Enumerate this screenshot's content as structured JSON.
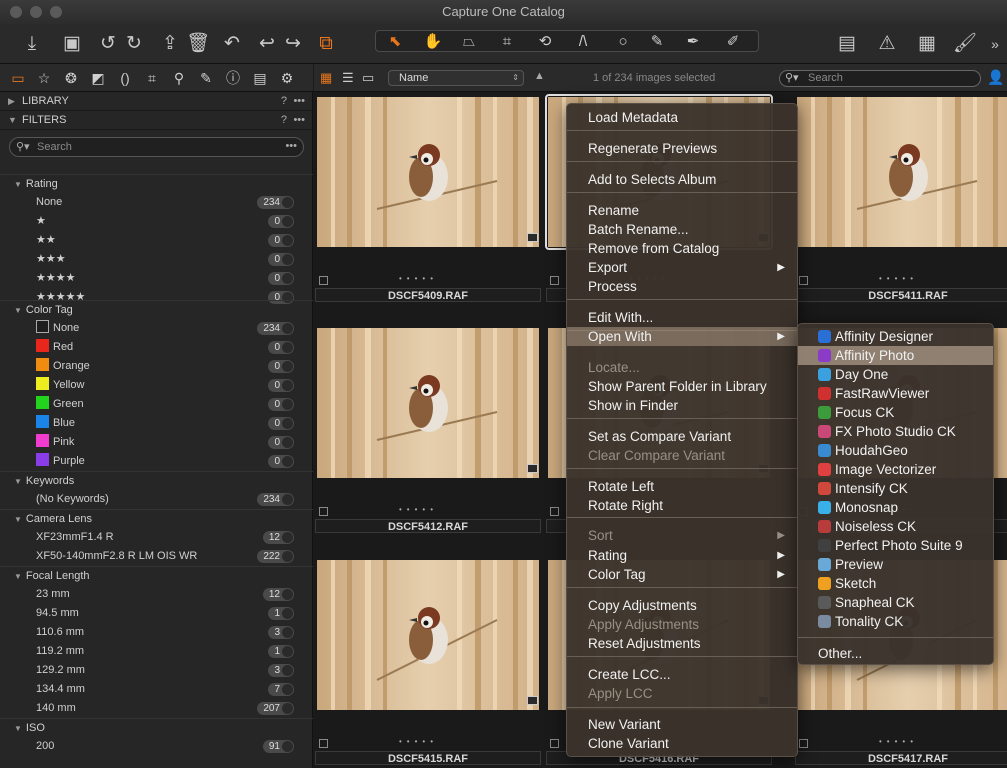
{
  "window": {
    "title": "Capture One Catalog"
  },
  "browser": {
    "sort_field": "Name",
    "selection_status": "1 of 234 images selected",
    "search_placeholder": "Search",
    "thumbnails": [
      {
        "filename": "DSCF5409.RAF"
      },
      {
        "filename": ""
      },
      {
        "filename": "DSCF5411.RAF"
      },
      {
        "filename": "DSCF5412.RAF"
      },
      {
        "filename": ""
      },
      {
        "filename": ""
      },
      {
        "filename": "DSCF5415.RAF"
      },
      {
        "filename": "DSCF5416.RAF"
      },
      {
        "filename": "DSCF5417.RAF"
      }
    ]
  },
  "sidebar": {
    "library_label": "LIBRARY",
    "filters_label": "FILTERS",
    "search_placeholder": "Search",
    "rating": {
      "title": "Rating",
      "items": [
        {
          "label": "None",
          "count": "234"
        },
        {
          "label": "★",
          "count": "0"
        },
        {
          "label": "★★",
          "count": "0"
        },
        {
          "label": "★★★",
          "count": "0"
        },
        {
          "label": "★★★★",
          "count": "0"
        },
        {
          "label": "★★★★★",
          "count": "0"
        }
      ]
    },
    "color_tag": {
      "title": "Color Tag",
      "items": [
        {
          "label": "None",
          "count": "234",
          "color": "#1e1e1e"
        },
        {
          "label": "Red",
          "count": "0",
          "color": "#e8261c"
        },
        {
          "label": "Orange",
          "count": "0",
          "color": "#f08c10"
        },
        {
          "label": "Yellow",
          "count": "0",
          "color": "#eded20"
        },
        {
          "label": "Green",
          "count": "0",
          "color": "#22d41e"
        },
        {
          "label": "Blue",
          "count": "0",
          "color": "#1a84e8"
        },
        {
          "label": "Pink",
          "count": "0",
          "color": "#f23ccf"
        },
        {
          "label": "Purple",
          "count": "0",
          "color": "#8a3ce8"
        }
      ]
    },
    "keywords": {
      "title": "Keywords",
      "items": [
        {
          "label": "(No Keywords)",
          "count": "234"
        }
      ]
    },
    "camera_lens": {
      "title": "Camera Lens",
      "items": [
        {
          "label": "XF23mmF1.4 R",
          "count": "12"
        },
        {
          "label": "XF50-140mmF2.8 R LM OIS WR",
          "count": "222"
        }
      ]
    },
    "focal_length": {
      "title": "Focal Length",
      "items": [
        {
          "label": "23 mm",
          "count": "12"
        },
        {
          "label": "94.5 mm",
          "count": "1"
        },
        {
          "label": "110.6 mm",
          "count": "3"
        },
        {
          "label": "119.2 mm",
          "count": "1"
        },
        {
          "label": "129.2 mm",
          "count": "3"
        },
        {
          "label": "134.4 mm",
          "count": "7"
        },
        {
          "label": "140 mm",
          "count": "207"
        }
      ]
    },
    "iso": {
      "title": "ISO",
      "items": [
        {
          "label": "200",
          "count": "91"
        }
      ]
    }
  },
  "context_menu": {
    "items": [
      {
        "label": "Load Metadata"
      },
      {
        "label": "Regenerate Previews"
      },
      {
        "label": "Add to Selects Album"
      },
      {
        "label": "Rename"
      },
      {
        "label": "Batch Rename..."
      },
      {
        "label": "Remove from Catalog"
      },
      {
        "label": "Export"
      },
      {
        "label": "Process"
      },
      {
        "label": "Edit With..."
      },
      {
        "label": "Open With"
      },
      {
        "label": "Locate..."
      },
      {
        "label": "Show Parent Folder in Library"
      },
      {
        "label": "Show in Finder"
      },
      {
        "label": "Set as Compare Variant"
      },
      {
        "label": "Clear Compare Variant"
      },
      {
        "label": "Rotate Left"
      },
      {
        "label": "Rotate Right"
      },
      {
        "label": "Sort"
      },
      {
        "label": "Rating"
      },
      {
        "label": "Color Tag"
      },
      {
        "label": "Copy Adjustments"
      },
      {
        "label": "Apply Adjustments"
      },
      {
        "label": "Reset Adjustments"
      },
      {
        "label": "Create LCC..."
      },
      {
        "label": "Apply LCC"
      },
      {
        "label": "New Variant"
      },
      {
        "label": "Clone Variant"
      }
    ]
  },
  "open_with_submenu": {
    "items": [
      {
        "label": "Affinity Designer",
        "icon": "affinity-designer-icon",
        "color": "#2a6fd6"
      },
      {
        "label": "Affinity Photo",
        "icon": "affinity-photo-icon",
        "color": "#8a3cc8"
      },
      {
        "label": "Day One",
        "icon": "day-one-icon",
        "color": "#3aa0e0"
      },
      {
        "label": "FastRawViewer",
        "icon": "fastrawviewer-icon",
        "color": "#d03030"
      },
      {
        "label": "Focus CK",
        "icon": "focus-ck-icon",
        "color": "#3c9c3c"
      },
      {
        "label": "FX Photo Studio CK",
        "icon": "fx-photo-studio-icon",
        "color": "#c84878"
      },
      {
        "label": "HoudahGeo",
        "icon": "houdahgeo-icon",
        "color": "#3a8ad0"
      },
      {
        "label": "Image Vectorizer",
        "icon": "image-vectorizer-icon",
        "color": "#e04040"
      },
      {
        "label": "Intensify CK",
        "icon": "intensify-ck-icon",
        "color": "#d0483c"
      },
      {
        "label": "Monosnap",
        "icon": "monosnap-icon",
        "color": "#3ab0e8"
      },
      {
        "label": "Noiseless CK",
        "icon": "noiseless-ck-icon",
        "color": "#b83c3c"
      },
      {
        "label": "Perfect Photo Suite 9",
        "icon": "perfect-photo-suite-icon",
        "color": "#404040"
      },
      {
        "label": "Preview",
        "icon": "preview-icon",
        "color": "#6aa8d8"
      },
      {
        "label": "Sketch",
        "icon": "sketch-icon",
        "color": "#f0a020"
      },
      {
        "label": "Snapheal CK",
        "icon": "snapheal-ck-icon",
        "color": "#5a5a5a"
      },
      {
        "label": "Tonality CK",
        "icon": "tonality-ck-icon",
        "color": "#7a8aa0"
      },
      {
        "label": "Other..."
      }
    ]
  }
}
